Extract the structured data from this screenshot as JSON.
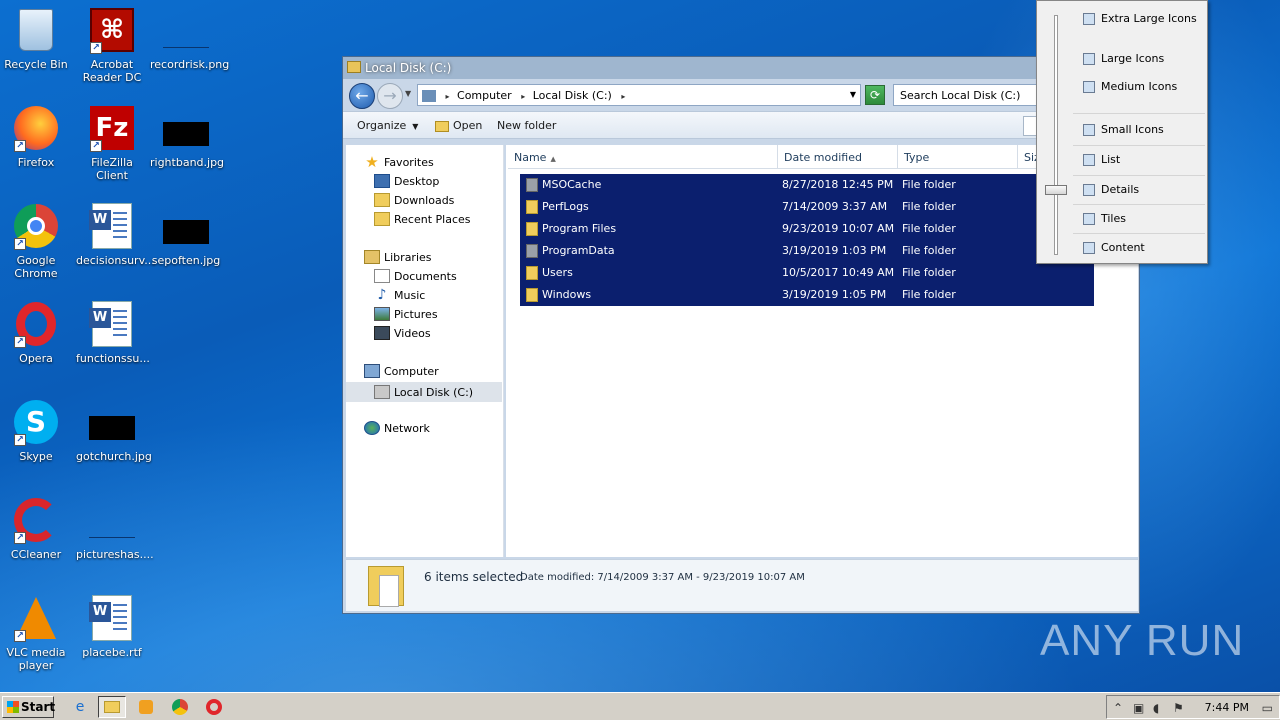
{
  "desktop": {
    "icons": [
      {
        "label": "Recycle Bin"
      },
      {
        "label": "Acrobat Reader DC"
      },
      {
        "label": "recordrisk.png"
      },
      {
        "label": "Firefox"
      },
      {
        "label": "FileZilla Client"
      },
      {
        "label": "rightband.jpg"
      },
      {
        "label": "Google Chrome"
      },
      {
        "label": "decisionsurv..."
      },
      {
        "label": "sepoften.jpg"
      },
      {
        "label": "Opera"
      },
      {
        "label": "functionssu..."
      },
      {
        "label": "Skype"
      },
      {
        "label": "gotchurch.jpg"
      },
      {
        "label": "CCleaner"
      },
      {
        "label": "pictureshas...."
      },
      {
        "label": "VLC media player"
      },
      {
        "label": "placebe.rtf"
      }
    ]
  },
  "window": {
    "title": "Local Disk (C:)",
    "address": {
      "seg1": "Computer",
      "seg2": "Local Disk (C:)"
    },
    "search_placeholder": "Search Local Disk (C:)",
    "toolbar": {
      "organize": "Organize",
      "open": "Open",
      "new_folder": "New folder"
    },
    "nav": {
      "favorites": "Favorites",
      "desktop": "Desktop",
      "downloads": "Downloads",
      "recent": "Recent Places",
      "libraries": "Libraries",
      "documents": "Documents",
      "music": "Music",
      "pictures": "Pictures",
      "videos": "Videos",
      "computer": "Computer",
      "local_disk": "Local Disk (C:)",
      "network": "Network"
    },
    "columns": {
      "name": "Name",
      "date": "Date modified",
      "type": "Type",
      "size": "Siz"
    },
    "files": [
      {
        "name": "MSOCache",
        "date": "8/27/2018 12:45 PM",
        "type": "File folder"
      },
      {
        "name": "PerfLogs",
        "date": "7/14/2009 3:37 AM",
        "type": "File folder"
      },
      {
        "name": "Program Files",
        "date": "9/23/2019 10:07 AM",
        "type": "File folder"
      },
      {
        "name": "ProgramData",
        "date": "3/19/2019 1:03 PM",
        "type": "File folder"
      },
      {
        "name": "Users",
        "date": "10/5/2017 10:49 AM",
        "type": "File folder"
      },
      {
        "name": "Windows",
        "date": "3/19/2019 1:05 PM",
        "type": "File folder"
      }
    ],
    "status": {
      "selected": "6 items selected",
      "date_range": "Date modified:  7/14/2009 3:37 AM - 9/23/2019 10:07 AM"
    }
  },
  "view_menu": {
    "items": [
      "Extra Large Icons",
      "Large Icons",
      "Medium Icons",
      "Small Icons",
      "List",
      "Details",
      "Tiles",
      "Content"
    ],
    "selected": "Details"
  },
  "taskbar": {
    "start": "Start",
    "clock": "7:44 PM"
  },
  "watermark": "ANY  RUN"
}
